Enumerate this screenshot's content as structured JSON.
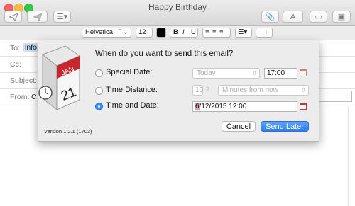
{
  "window": {
    "title": "Happy Birthday"
  },
  "toolbar": {
    "send_icon": "paper-plane-icon",
    "later_icon": "paper-plane-dim-icon",
    "list_icon": "list-icon",
    "attach_icon": "paperclip-icon",
    "font_icon": "A",
    "browser_icon": "window-icon",
    "photo_icon": "photo-icon"
  },
  "format": {
    "font": "Helvetica",
    "size": "12",
    "bold": "B",
    "italic": "I",
    "underline": "U",
    "indent": "→|"
  },
  "compose": {
    "to_label": "To:",
    "to_value": "info",
    "cc_label": "Cc:",
    "subject_label": "Subject:",
    "from_label": "From:",
    "from_value": "C"
  },
  "dialog": {
    "question": "When do you want to send this email?",
    "options": [
      {
        "label": "Special Date:",
        "selected": false
      },
      {
        "label": "Time Distance:",
        "selected": false
      },
      {
        "label": "Time and Date:",
        "selected": true
      }
    ],
    "special_date_value": "Today",
    "special_time_value": "17:00",
    "distance_amount": "10",
    "distance_unit": "Minutes from now",
    "datetime_highlight": "6",
    "datetime_rest": "/12/2015 12:00",
    "cancel_label": "Cancel",
    "send_later_label": "Send Later",
    "version": "Version 1.2.1 (1703)",
    "icon_month": "JAN",
    "icon_day": "21"
  },
  "colors": {
    "accent": "#2d7ef1",
    "calendar_red": "#c0392b",
    "highlight": "#d9a3b3"
  }
}
